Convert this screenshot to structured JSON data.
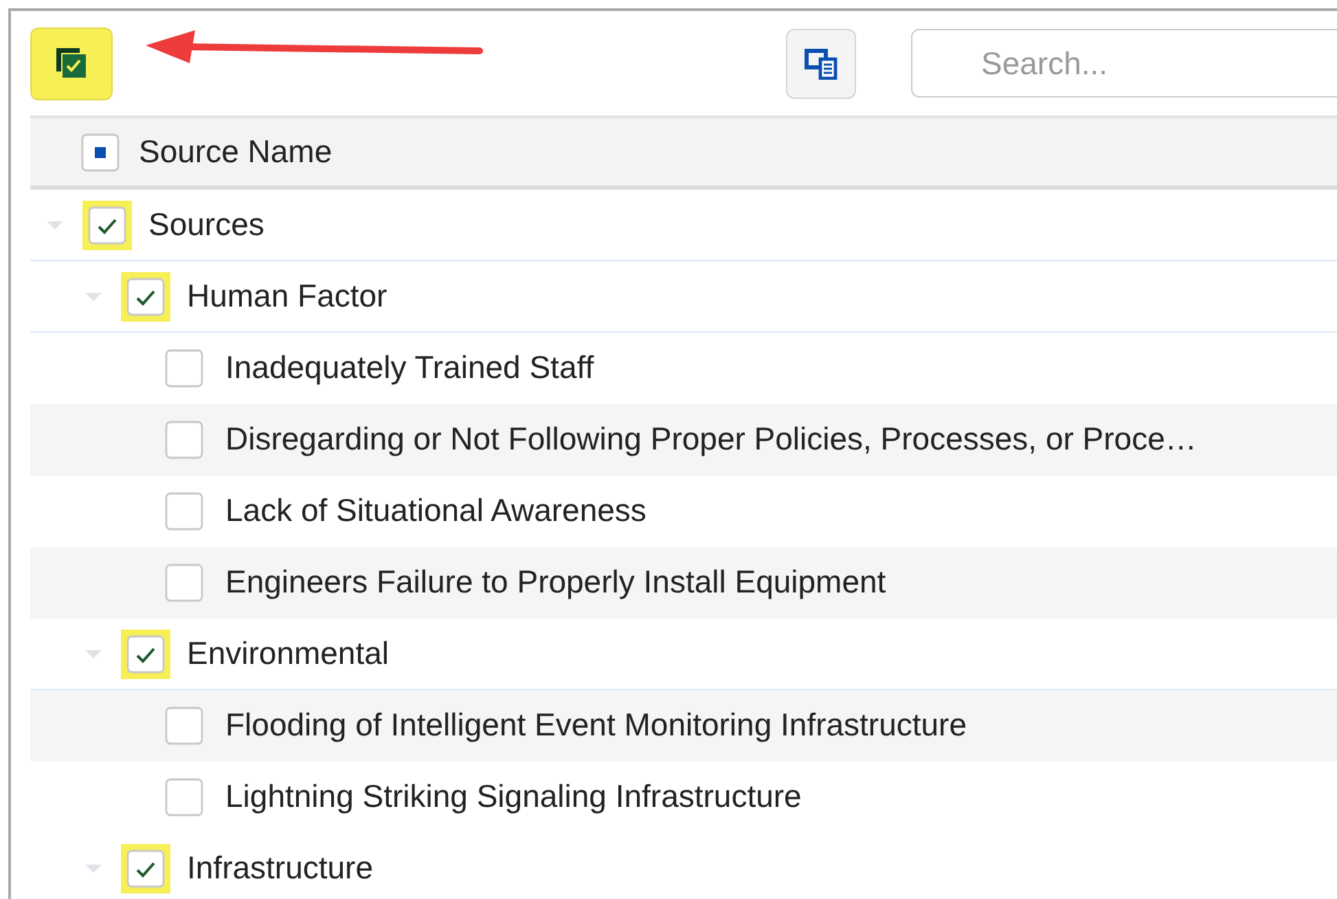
{
  "toolbar": {
    "select_all_button": {
      "highlighted": true
    },
    "search": {
      "placeholder": "Search..."
    }
  },
  "table": {
    "header": {
      "label": "Source Name",
      "indeterminate": true
    },
    "rows": [
      {
        "label": "Sources",
        "checked": true,
        "highlighted": true,
        "expanded": true,
        "children": [
          {
            "label": "Human Factor",
            "checked": true,
            "highlighted": true,
            "expanded": true,
            "children": [
              {
                "label": "Inadequately Trained Staff",
                "checked": false,
                "highlighted": false
              },
              {
                "label": "Disregarding or Not Following Proper Policies, Processes, or Proce…",
                "checked": false,
                "highlighted": false
              },
              {
                "label": "Lack of Situational Awareness",
                "checked": false,
                "highlighted": false
              },
              {
                "label": "Engineers Failure to Properly Install Equipment",
                "checked": false,
                "highlighted": false
              }
            ]
          },
          {
            "label": "Environmental",
            "checked": true,
            "highlighted": true,
            "expanded": true,
            "children": [
              {
                "label": "Flooding of Intelligent Event Monitoring Infrastructure",
                "checked": false,
                "highlighted": false
              },
              {
                "label": "Lightning Striking Signaling Infrastructure",
                "checked": false,
                "highlighted": false
              }
            ]
          },
          {
            "label": "Infrastructure",
            "checked": true,
            "highlighted": true,
            "expanded": true
          }
        ]
      }
    ]
  }
}
